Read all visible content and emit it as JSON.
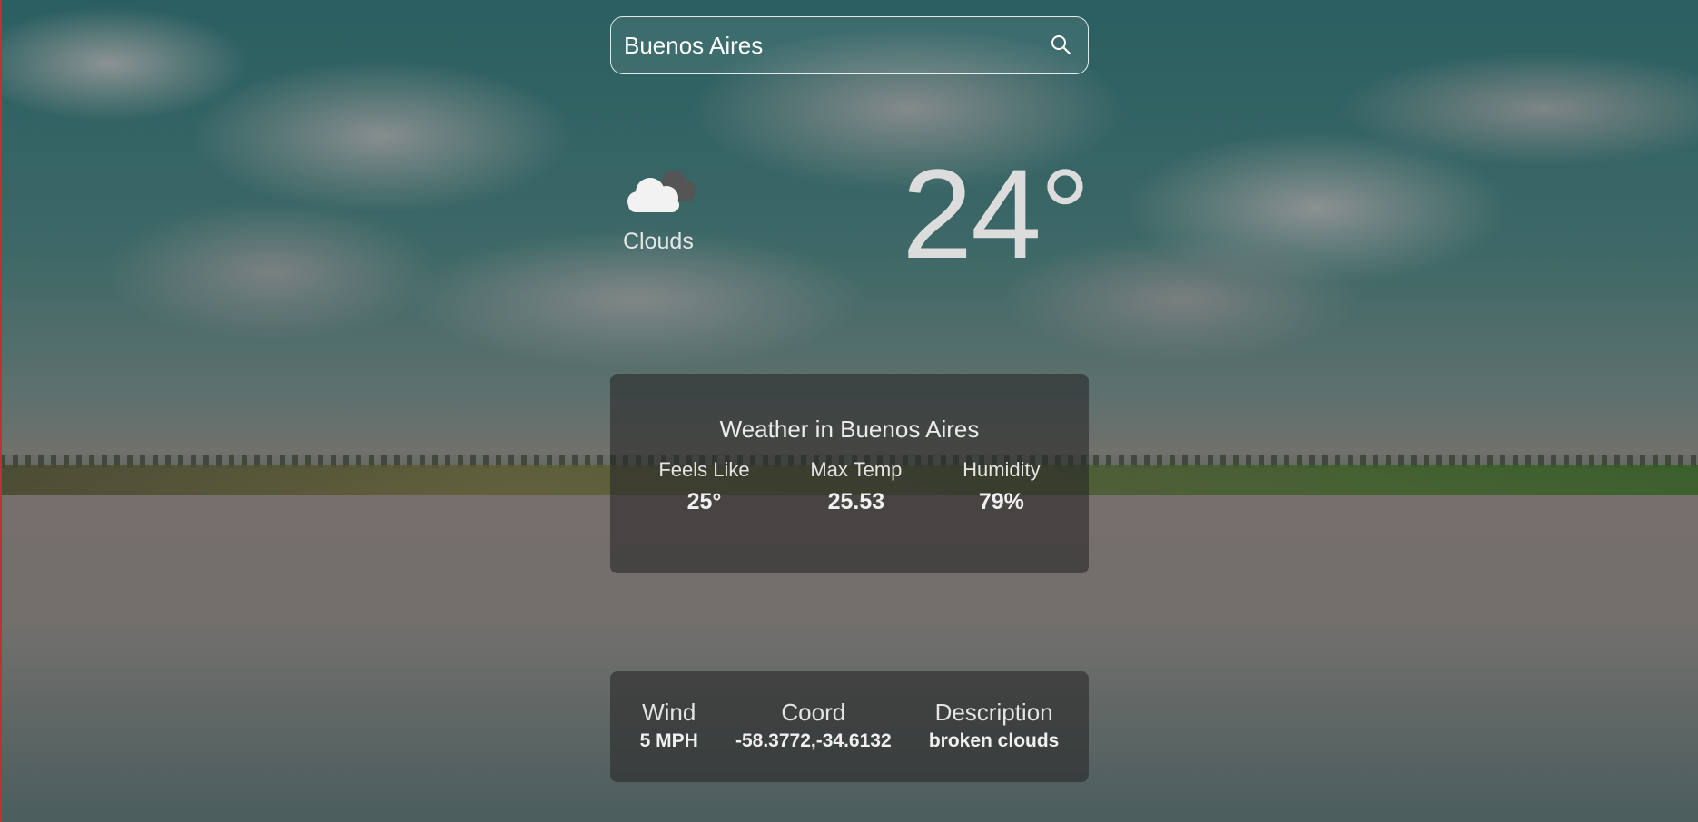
{
  "search": {
    "value": "Buenos Aires",
    "icon": "search-icon"
  },
  "current": {
    "condition": "Clouds",
    "condition_icon": "cloud-icon",
    "temperature": "24°"
  },
  "details": {
    "title": "Weather in Buenos Aires",
    "stats": [
      {
        "label": "Feels Like",
        "value": "25°"
      },
      {
        "label": "Max Temp",
        "value": "25.53"
      },
      {
        "label": "Humidity",
        "value": "79%"
      }
    ]
  },
  "extra": {
    "stats": [
      {
        "label": "Wind",
        "value": "5 MPH"
      },
      {
        "label": "Coord",
        "value": "-58.3772,-34.6132"
      },
      {
        "label": "Description",
        "value": "broken clouds"
      }
    ]
  }
}
